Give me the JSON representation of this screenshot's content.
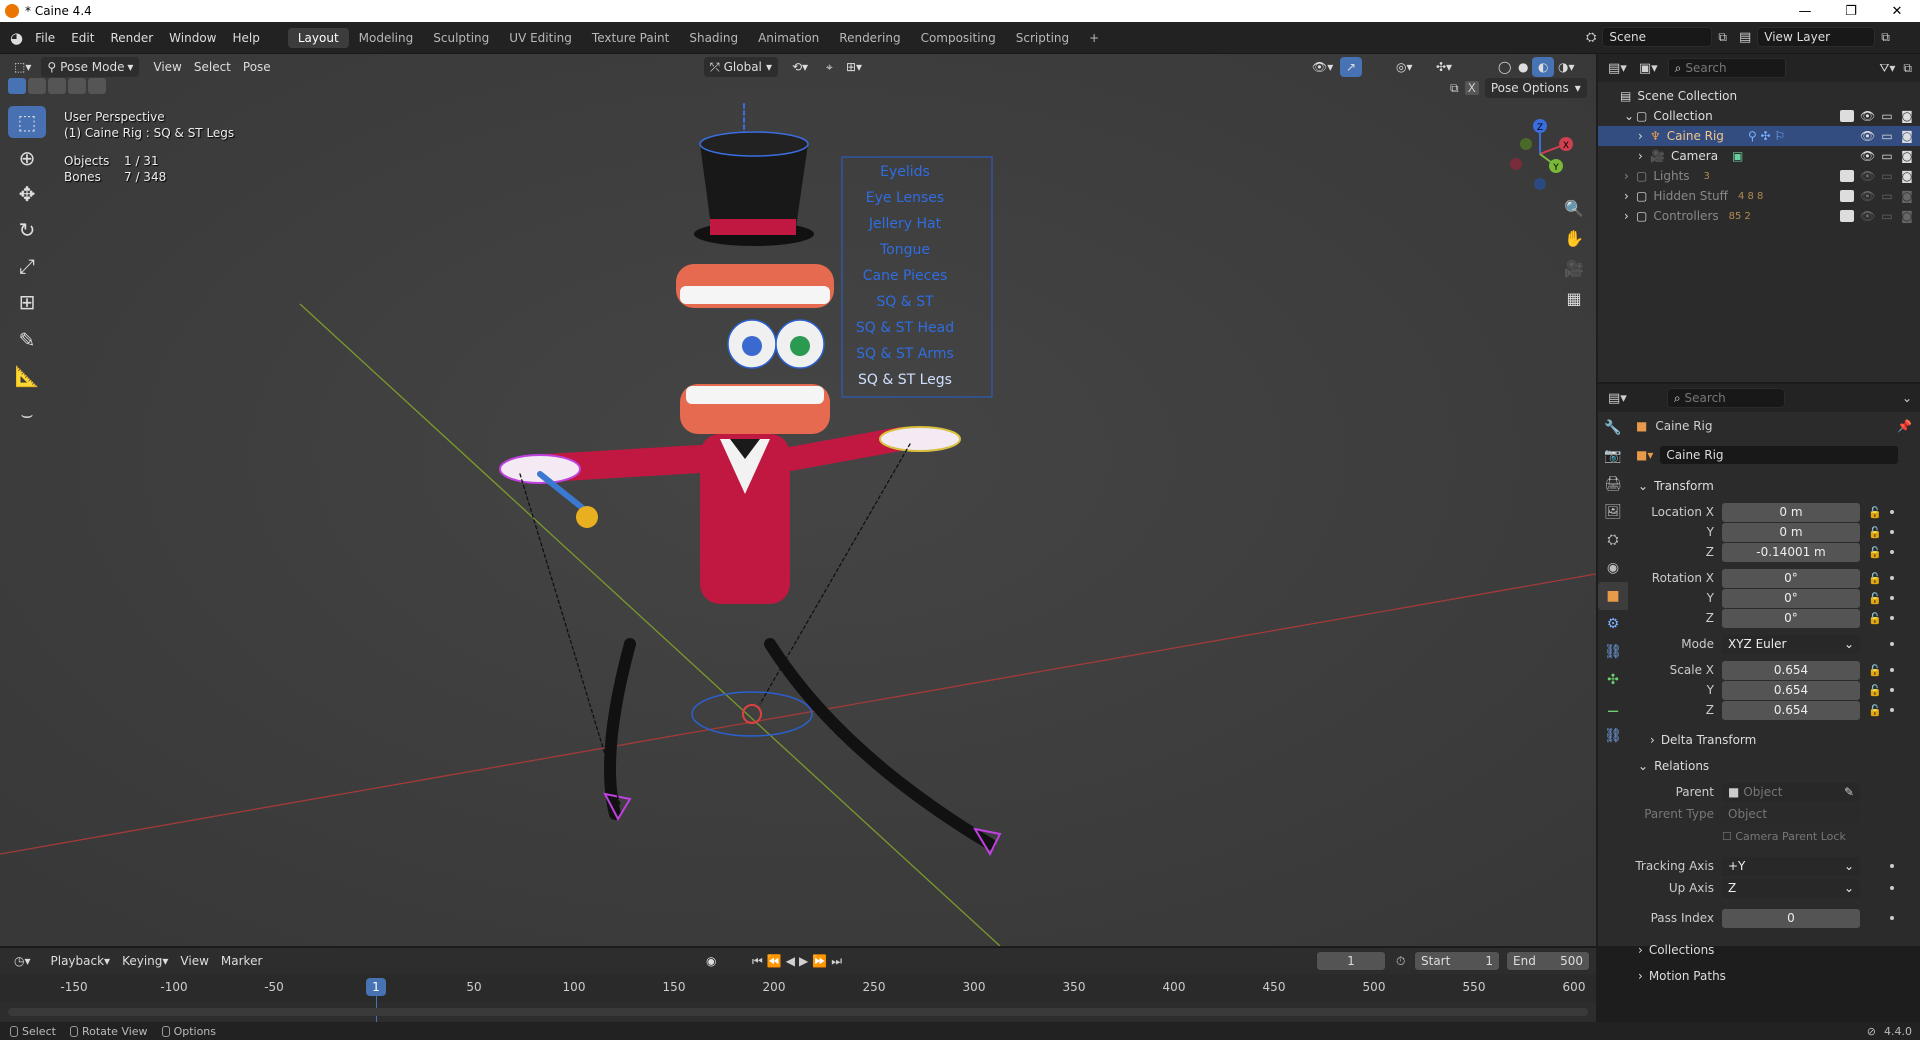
{
  "window": {
    "title": "* Caine 4.4",
    "min": "—",
    "max": "❐",
    "close": "✕"
  },
  "menus": [
    "File",
    "Edit",
    "Render",
    "Window",
    "Help"
  ],
  "workspaces": [
    "Layout",
    "Modeling",
    "Sculpting",
    "UV Editing",
    "Texture Paint",
    "Shading",
    "Animation",
    "Rendering",
    "Compositing",
    "Scripting"
  ],
  "active_workspace": "Layout",
  "add_tab": "+",
  "scene": {
    "label": "Scene",
    "view_layer": "View Layer"
  },
  "viewport_header": {
    "mode": "Pose Mode",
    "menus": [
      "View",
      "Select",
      "Pose"
    ],
    "orientation": "Global",
    "pose_options": "Pose Options"
  },
  "viewport_info": {
    "perspective": "User Perspective",
    "context": "(1) Caine Rig : SQ & ST Legs",
    "objects_label": "Objects",
    "objects_value": "1 / 31",
    "bones_label": "Bones",
    "bones_value": "7 / 348"
  },
  "gizmo_axes": {
    "x": "X",
    "y": "Y",
    "z": "Z"
  },
  "bone_layers": [
    "Eyelids",
    "Eye Lenses",
    "Jellery Hat",
    "Tongue",
    "Cane Pieces",
    "SQ & ST",
    "SQ & ST Head",
    "SQ & ST Arms",
    "SQ & ST Legs"
  ],
  "outliner": {
    "search_placeholder": "Search",
    "root": "Scene Collection",
    "items": [
      {
        "name": "Collection",
        "depth": 0,
        "selected": false,
        "dim": false,
        "badges": ""
      },
      {
        "name": "Caine Rig",
        "depth": 1,
        "selected": true,
        "dim": false,
        "badges": ""
      },
      {
        "name": "Camera",
        "depth": 1,
        "selected": false,
        "dim": false,
        "badges": ""
      },
      {
        "name": "Lights",
        "depth": 0,
        "selected": false,
        "dim": true,
        "badges": "3"
      },
      {
        "name": "Hidden Stuff",
        "depth": 0,
        "selected": false,
        "dim": true,
        "badges": "4 8 8"
      },
      {
        "name": "Controllers",
        "depth": 0,
        "selected": false,
        "dim": true,
        "badges": "85 2"
      }
    ]
  },
  "properties": {
    "search_placeholder": "Search",
    "object_name": "Caine Rig",
    "datablock_name": "Caine Rig",
    "transform_label": "Transform",
    "location": {
      "label": "Location X",
      "x": "0 m",
      "y": "0 m",
      "z": "-0.14001 m"
    },
    "rotation": {
      "label": "Rotation X",
      "x": "0°",
      "y": "0°",
      "z": "0°"
    },
    "mode_label": "Mode",
    "mode_value": "XYZ Euler",
    "scale": {
      "label": "Scale X",
      "x": "0.654",
      "y": "0.654",
      "z": "0.654"
    },
    "axis_y": "Y",
    "axis_z": "Z",
    "delta_transform": "Delta Transform",
    "relations_label": "Relations",
    "parent_label": "Parent",
    "parent_placeholder": "Object",
    "parent_type_label": "Parent Type",
    "parent_type_value": "Object",
    "camera_parent_lock": "Camera Parent Lock",
    "tracking_axis_label": "Tracking Axis",
    "tracking_axis_value": "+Y",
    "up_axis_label": "Up Axis",
    "up_axis_value": "Z",
    "pass_index_label": "Pass Index",
    "pass_index_value": "0",
    "collections_label": "Collections",
    "motion_paths_label": "Motion Paths"
  },
  "timeline": {
    "menus": [
      "Playback",
      "Keying",
      "View",
      "Marker"
    ],
    "current_frame": "1",
    "start_label": "Start",
    "start_value": "1",
    "end_label": "End",
    "end_value": "500",
    "ticks": [
      "-150",
      "-100",
      "-50",
      "1",
      "50",
      "100",
      "150",
      "200",
      "250",
      "300",
      "350",
      "400",
      "450",
      "500",
      "550",
      "600"
    ]
  },
  "statusbar": {
    "select": "Select",
    "rotate": "Rotate View",
    "options": "Options",
    "version": "4.4.0"
  },
  "colors": {
    "accent": "#4772b3",
    "selected_row": "#334d80",
    "viewport": "#3e3e3e"
  }
}
